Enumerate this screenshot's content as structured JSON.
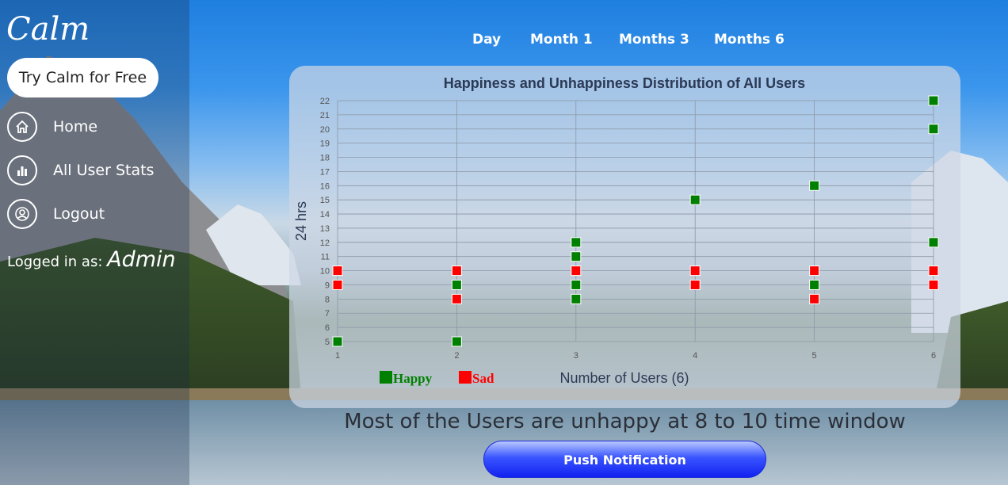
{
  "sidebar": {
    "logo_text": "Calm",
    "try_label": "Try Calm for Free",
    "items": [
      {
        "label": "Home",
        "icon": "home-icon"
      },
      {
        "label": "All User Stats",
        "icon": "bar-chart-icon"
      },
      {
        "label": "Logout",
        "icon": "user-circle-icon"
      }
    ],
    "logged_prefix": "Logged in as:",
    "logged_user": "Admin"
  },
  "tabs": [
    "Day",
    "Month 1",
    "Months 3",
    "Months 6"
  ],
  "chart_data": {
    "type": "scatter",
    "title": "Happiness and Unhappiness Distribution of All Users",
    "xlabel": "Number of Users (6)",
    "ylabel": "24 hrs",
    "xlim": [
      1,
      6
    ],
    "ylim": [
      5,
      22
    ],
    "x_ticks": [
      "1",
      "2",
      "3",
      "4",
      "5",
      "6"
    ],
    "y_ticks": [
      "5",
      "6",
      "7",
      "8",
      "9",
      "10",
      "11",
      "12",
      "13",
      "14",
      "15",
      "16",
      "17",
      "18",
      "19",
      "20",
      "21",
      "22"
    ],
    "grid": true,
    "legend": "bottom-left",
    "series": [
      {
        "name": "Happy",
        "color": "#008000",
        "points": [
          [
            1,
            5
          ],
          [
            2,
            5
          ],
          [
            2,
            9
          ],
          [
            3,
            8
          ],
          [
            3,
            9
          ],
          [
            3,
            11
          ],
          [
            3,
            12
          ],
          [
            4,
            15
          ],
          [
            5,
            9
          ],
          [
            5,
            16
          ],
          [
            6,
            12
          ],
          [
            6,
            20
          ],
          [
            6,
            22
          ]
        ]
      },
      {
        "name": "Sad",
        "color": "#ff0000",
        "points": [
          [
            1,
            9
          ],
          [
            1,
            10
          ],
          [
            2,
            8
          ],
          [
            2,
            10
          ],
          [
            3,
            10
          ],
          [
            4,
            9
          ],
          [
            4,
            10
          ],
          [
            5,
            8
          ],
          [
            5,
            10
          ],
          [
            6,
            9
          ],
          [
            6,
            10
          ]
        ]
      }
    ]
  },
  "conclusion": "Most of the Users are unhappy at 8 to 10 time window",
  "push_label": "Push Notification"
}
